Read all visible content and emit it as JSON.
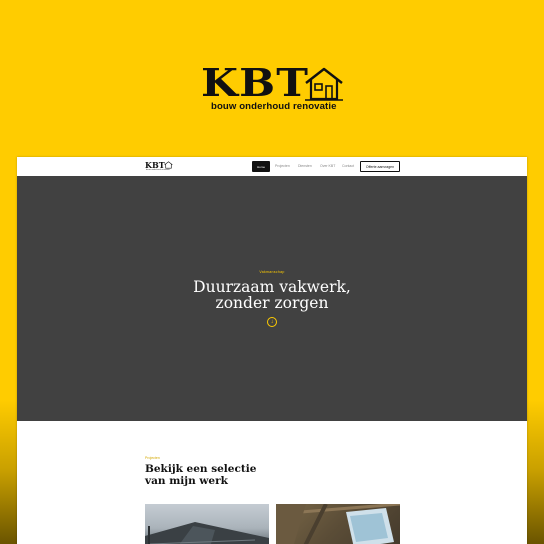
{
  "brand": {
    "name": "KBT",
    "tagline": "bouw onderhoud renovatie"
  },
  "site": {
    "nav": {
      "logo_name": "KBT",
      "logo_tagline": "bouw onderhoud renovatie",
      "home_label": "Home",
      "links": [
        "Projecten",
        "Diensten",
        "Over KBT",
        "Contact"
      ],
      "cta_label": "Offerte aanvragen"
    },
    "hero": {
      "kicker": "Vakmanschap",
      "title_line1": "Duurzaam vakwerk,",
      "title_line2": "zonder zorgen",
      "scroll_icon": "arrow-down-icon"
    },
    "projects": {
      "kicker": "Projecten",
      "title_line1": "Bekijk een selectie",
      "title_line2": "van mijn werk"
    }
  },
  "colors": {
    "brand_yellow": "#ffcc00",
    "hero_bg": "#414141",
    "text_dark": "#111111"
  }
}
